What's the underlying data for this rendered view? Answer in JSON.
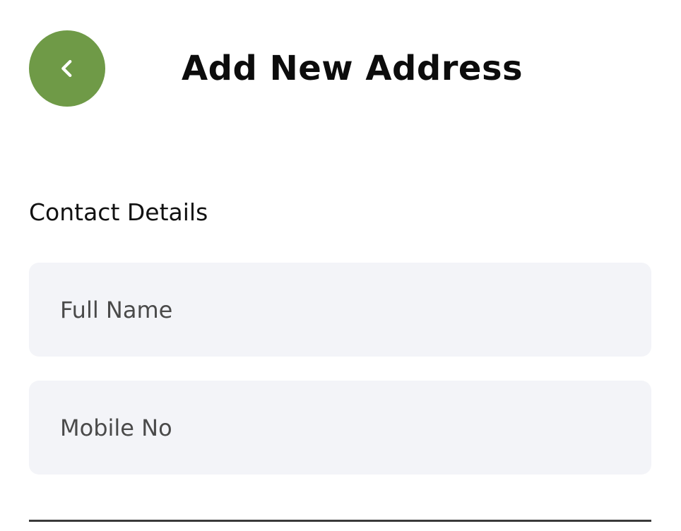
{
  "header": {
    "back_icon": "chevron-left-icon",
    "title": "Add New Address"
  },
  "contact_section": {
    "heading": "Contact Details",
    "fields": {
      "full_name": {
        "value": "",
        "placeholder": "Full Name"
      },
      "mobile_no": {
        "value": "",
        "placeholder": "Mobile No"
      }
    }
  },
  "colors": {
    "accent": "#6f9a47",
    "field_background": "#f3f4f8",
    "title_text": "#0c0c0c",
    "placeholder_text": "#4a4a4a"
  }
}
